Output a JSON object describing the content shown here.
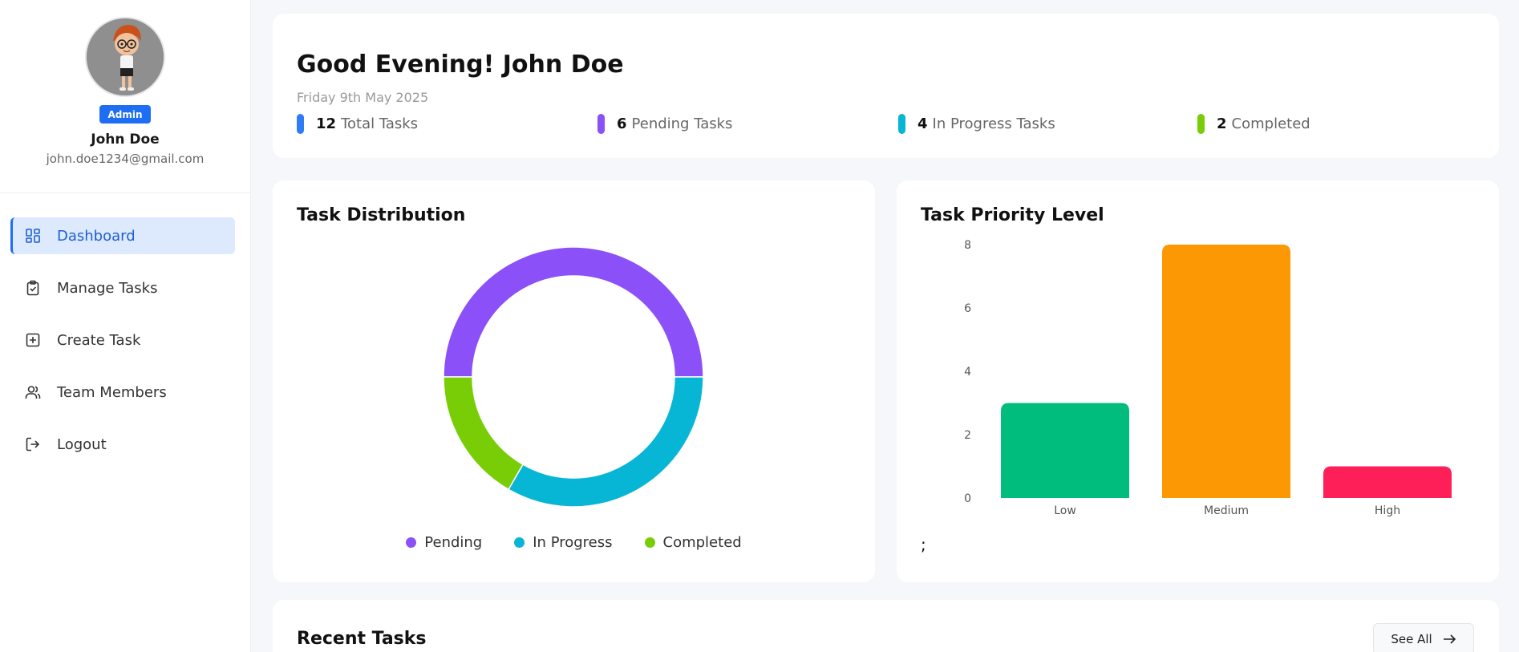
{
  "profile": {
    "role": "Admin",
    "name": "John Doe",
    "email": "john.doe1234@gmail.com"
  },
  "sidebar": {
    "items": [
      {
        "label": "Dashboard",
        "icon": "dashboard-icon",
        "active": true
      },
      {
        "label": "Manage Tasks",
        "icon": "clipboard-check-icon"
      },
      {
        "label": "Create Task",
        "icon": "plus-square-icon"
      },
      {
        "label": "Team Members",
        "icon": "users-icon"
      },
      {
        "label": "Logout",
        "icon": "logout-icon"
      }
    ]
  },
  "header": {
    "greeting": "Good Evening! John Doe",
    "date": "Friday 9th May 2025",
    "stats": [
      {
        "value": "12",
        "label": "Total Tasks",
        "color": "#2f7cf6"
      },
      {
        "value": "6",
        "label": "Pending Tasks",
        "color": "#8b50f7"
      },
      {
        "value": "4",
        "label": "In Progress Tasks",
        "color": "#06b6d4"
      },
      {
        "value": "2",
        "label": "Completed",
        "color": "#78cd06"
      }
    ]
  },
  "distribution": {
    "title": "Task Distribution"
  },
  "priority": {
    "title": "Task Priority Level",
    "trailing_text": ";"
  },
  "recent": {
    "title": "Recent Tasks",
    "see_all_label": "See All"
  },
  "chart_data": [
    {
      "type": "pie",
      "title": "Task Distribution",
      "categories": [
        "Pending",
        "In Progress",
        "Completed"
      ],
      "values": [
        6,
        4,
        2
      ],
      "colors": [
        "#8b50f7",
        "#06b6d4",
        "#78cd06"
      ],
      "legend": "bottom"
    },
    {
      "type": "bar",
      "title": "Task Priority Level",
      "categories": [
        "Low",
        "Medium",
        "High"
      ],
      "values": [
        3,
        8,
        1
      ],
      "colors": [
        "#00bd7e",
        "#fc9804",
        "#fe1f58"
      ],
      "yticks": [
        0,
        2,
        4,
        6,
        8
      ],
      "ylim": [
        0,
        8
      ],
      "grid": false
    }
  ]
}
